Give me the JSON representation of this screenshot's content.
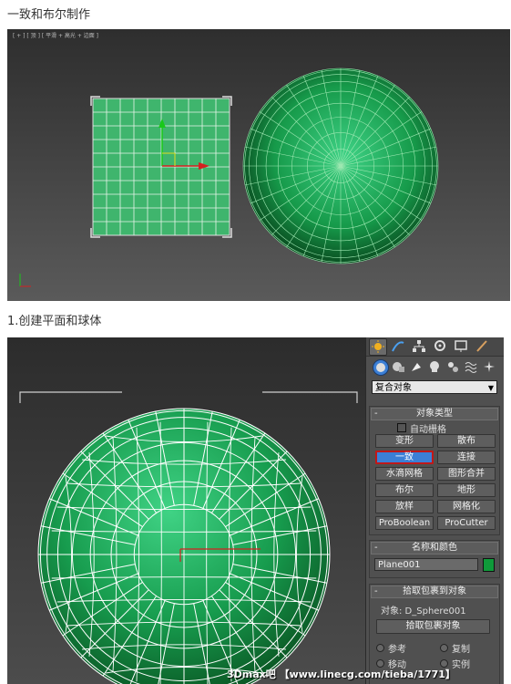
{
  "captions": {
    "title": "一致和布尔制作",
    "step1": "1.创建平面和球体"
  },
  "viewport_top": {
    "label": "[ + ] [ 顶 ] [ 平滑 + 高光 + 边面 ]"
  },
  "panel": {
    "dropdown_value": "复合对象",
    "object_type": {
      "title": "对象类型",
      "auto_grid": "自动栅格",
      "buttons": [
        "变形",
        "散布",
        "一致",
        "连接",
        "水滴网格",
        "图形合并",
        "布尔",
        "地形",
        "放样",
        "网格化",
        "ProBoolean",
        "ProCutter"
      ],
      "active": "一致"
    },
    "name_color": {
      "title": "名称和颜色",
      "name_value": "Plane001",
      "color": "#0f9a3a"
    },
    "pick": {
      "title": "拾取包裹到对象",
      "object_label": "对象: D_Sphere001",
      "pick_button": "拾取包裹对象",
      "options": [
        "参考",
        "复制",
        "移动",
        "实例"
      ]
    }
  },
  "watermark": "3Dmax吧 【www.linecg.com/tieba/1771】",
  "colors": {
    "viewport_bg": "#4a4a4a",
    "plane_fill": "#3fb56d",
    "sphere_dark": "#0a3a18",
    "sphere_light": "#3fd286",
    "wire": "#ffffff",
    "active_button": "#3b7fd6",
    "highlight_border": "#c01818"
  }
}
